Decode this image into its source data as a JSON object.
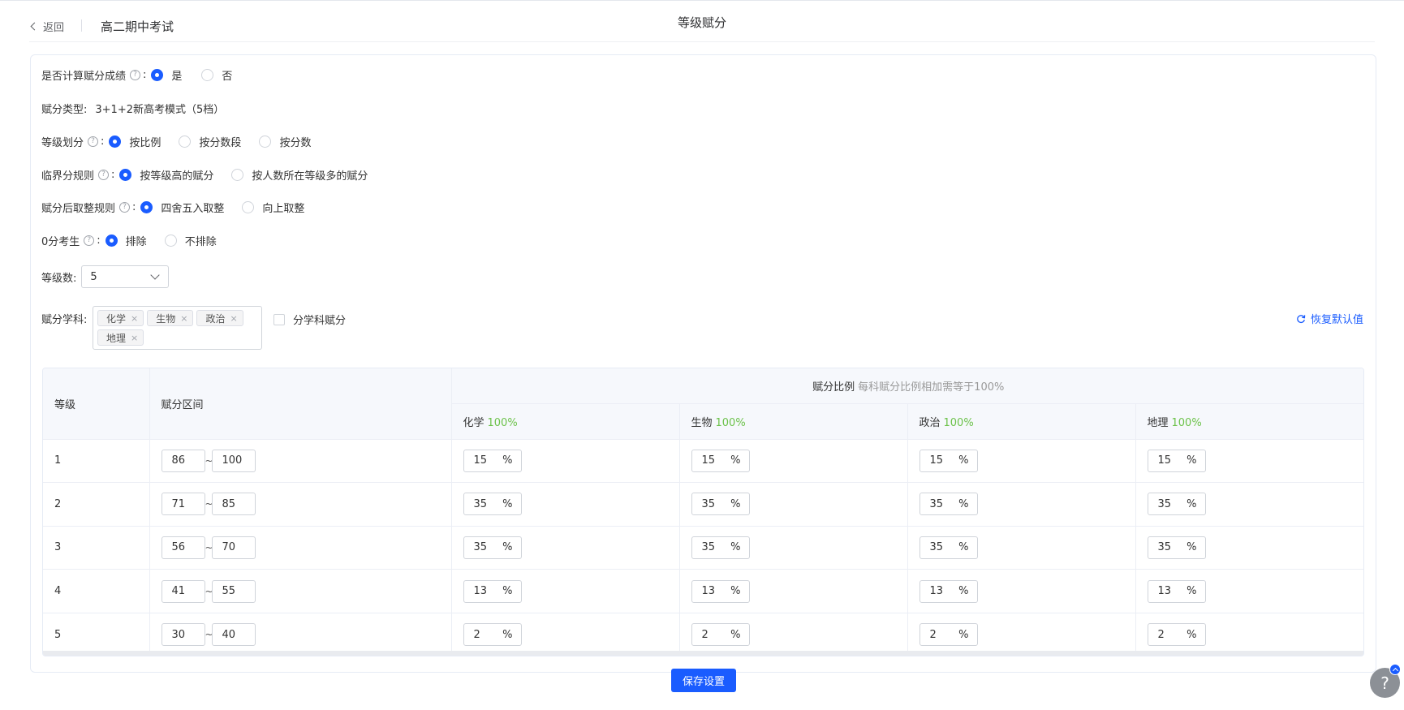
{
  "header": {
    "back_label": "返回",
    "exam_name": "高二期中考试",
    "title": "等级赋分"
  },
  "settings": {
    "calc": {
      "label": "是否计算赋分成绩",
      "options": [
        "是",
        "否"
      ],
      "selected": "是"
    },
    "type": {
      "label": "赋分类型:",
      "value": "3+1+2新高考模式（5档）"
    },
    "division": {
      "label": "等级划分",
      "options": [
        "按比例",
        "按分数段",
        "按分数"
      ],
      "selected": "按比例"
    },
    "boundary": {
      "label": "临界分规则",
      "options": [
        "按等级高的赋分",
        "按人数所在等级多的赋分"
      ],
      "selected": "按等级高的赋分"
    },
    "rounding": {
      "label": "赋分后取整规则",
      "options": [
        "四舍五入取整",
        "向上取整"
      ],
      "selected": "四舍五入取整"
    },
    "zero": {
      "label": "0分考生",
      "options": [
        "排除",
        "不排除"
      ],
      "selected": "排除"
    },
    "levels": {
      "label": "等级数:",
      "value": "5"
    },
    "subjects": {
      "label": "赋分学科:",
      "tags": [
        "化学",
        "生物",
        "政治",
        "地理"
      ],
      "per_subject_label": "分学科赋分"
    },
    "reset_label": "恢复默认值"
  },
  "table": {
    "col_level": "等级",
    "col_range": "赋分区间",
    "col_ratio": "赋分比例",
    "ratio_hint": "每科赋分比例相加需等于100%",
    "subjects": [
      {
        "name": "化学",
        "total": "100%"
      },
      {
        "name": "生物",
        "total": "100%"
      },
      {
        "name": "政治",
        "total": "100%"
      },
      {
        "name": "地理",
        "total": "100%"
      }
    ],
    "rows": [
      {
        "level": "1",
        "min": "86",
        "max": "100",
        "pcts": [
          "15",
          "15",
          "15",
          "15"
        ]
      },
      {
        "level": "2",
        "min": "71",
        "max": "85",
        "pcts": [
          "35",
          "35",
          "35",
          "35"
        ]
      },
      {
        "level": "3",
        "min": "56",
        "max": "70",
        "pcts": [
          "35",
          "35",
          "35",
          "35"
        ]
      },
      {
        "level": "4",
        "min": "41",
        "max": "55",
        "pcts": [
          "13",
          "13",
          "13",
          "13"
        ]
      },
      {
        "level": "5",
        "min": "30",
        "max": "40",
        "pcts": [
          "2",
          "2",
          "2",
          "2"
        ]
      }
    ],
    "tilde": "~",
    "pct_sign": "%"
  },
  "save_label": "保存设置",
  "help_mark": "?",
  "help_float": "?",
  "colors": {
    "primary": "#1a5cff",
    "green": "#6cc24a"
  }
}
